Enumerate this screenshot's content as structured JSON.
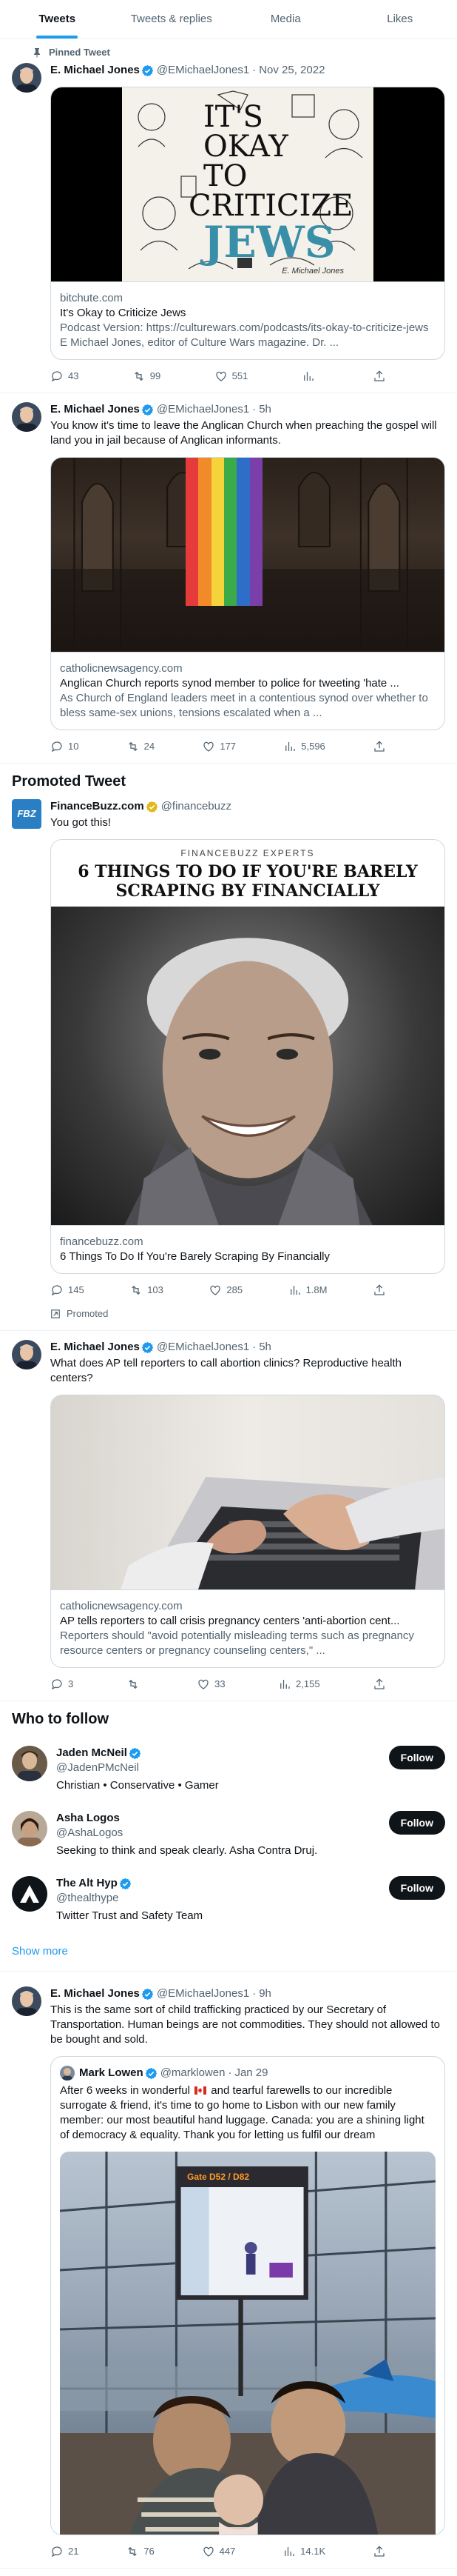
{
  "tabs": [
    "Tweets",
    "Tweets & replies",
    "Media",
    "Likes"
  ],
  "colors": {
    "accent": "#1d9bf0",
    "text": "#0f1419",
    "muted": "#536471",
    "border": "#eff3f4",
    "verified": "#1d9bf0",
    "gold": "#e2b719"
  },
  "tweets": [
    {
      "pinned_label": "Pinned Tweet",
      "name": "E. Michael Jones",
      "handle": "@EMichaelJones1",
      "time": "Nov 25, 2022",
      "text": "",
      "card": {
        "image_text": [
          "IT'S",
          "OKAY",
          "TO",
          "CRITICIZE",
          "JEWS"
        ],
        "image_caption": "E. Michael Jones",
        "domain": "bitchute.com",
        "title": "It's Okay to Criticize Jews",
        "desc": "Podcast Version: https://culturewars.com/podcasts/its-okay-to-criticize-jews E Michael Jones, editor of Culture Wars magazine. Dr. ..."
      },
      "stats": {
        "replies": "43",
        "retweets": "99",
        "likes": "551",
        "views": ""
      }
    },
    {
      "name": "E. Michael Jones",
      "handle": "@EMichaelJones1",
      "time": "5h",
      "text": "You know it's time to leave the Anglican Church when preaching the gospel will land you in jail because of Anglican informants.",
      "card": {
        "domain": "catholicnewsagency.com",
        "title": "Anglican Church reports synod member to police for tweeting 'hate ...",
        "desc": "As Church of England leaders meet in a contentious synod over whether to bless same-sex unions, tensions escalated when a ..."
      },
      "stats": {
        "replies": "10",
        "retweets": "24",
        "likes": "177",
        "views": "5,596"
      }
    }
  ],
  "promoted": {
    "section_title": "Promoted Tweet",
    "name": "FinanceBuzz.com",
    "logo_text": "FBZ",
    "handle": "@financebuzz",
    "text": "You got this!",
    "card": {
      "kicker": "FINANCEBUZZ EXPERTS",
      "headline": "6 THINGS TO DO IF YOU'RE BARELY SCRAPING BY FINANCIALLY",
      "domain": "financebuzz.com",
      "title": "6 Things To Do If You're Barely Scraping By Financially"
    },
    "stats": {
      "replies": "145",
      "retweets": "103",
      "likes": "285",
      "views": "1.8M"
    },
    "promoted_label": "Promoted"
  },
  "tweet3": {
    "name": "E. Michael Jones",
    "handle": "@EMichaelJones1",
    "time": "5h",
    "text": "What does AP tell reporters to call abortion clinics? Reproductive health centers?",
    "card": {
      "domain": "catholicnewsagency.com",
      "title": "AP tells reporters to call crisis pregnancy centers 'anti-abortion cent...",
      "desc": "Reporters should \"avoid potentially misleading terms such as pregnancy resource centers or pregnancy counseling centers,\" ..."
    },
    "stats": {
      "replies": "3",
      "retweets": "",
      "likes": "33",
      "views": "2,155"
    }
  },
  "who_to_follow": {
    "title": "Who to follow",
    "users": [
      {
        "name": "Jaden McNeil",
        "handle": "@JadenPMcNeil",
        "bio": "Christian • Conservative • Gamer",
        "button": "Follow"
      },
      {
        "name": "Asha Logos",
        "handle": "@AshaLogos",
        "bio": "Seeking to think and speak clearly. Asha Contra Druj.",
        "button": "Follow"
      },
      {
        "name": "The Alt Hyp",
        "handle": "@thealthype",
        "bio": "Twitter Trust and Safety Team",
        "button": "Follow"
      }
    ],
    "show_more": "Show more"
  },
  "tweet4": {
    "name": "E. Michael Jones",
    "handle": "@EMichaelJones1",
    "time": "9h",
    "text": "This is the same sort of child trafficking practiced by our Secretary of Transportation. Human beings are not commodities. They should not allowed to be bought and sold.",
    "quote": {
      "name": "Mark Lowen",
      "handle": "@marklowen",
      "time": "Jan 29",
      "text_before": "After 6 weeks in wonderful ",
      "text_after": " and tearful farewells to our incredible surrogate & friend, it's time to go home to Lisbon with our new family member: our most beautiful hand luggage. Canada: you are a shining light of democracy & equality. Thank you for letting us fulfil our dream",
      "gate_text": "Gate D52 / D82"
    },
    "stats": {
      "replies": "21",
      "retweets": "76",
      "likes": "447",
      "views": "14.1K"
    }
  }
}
